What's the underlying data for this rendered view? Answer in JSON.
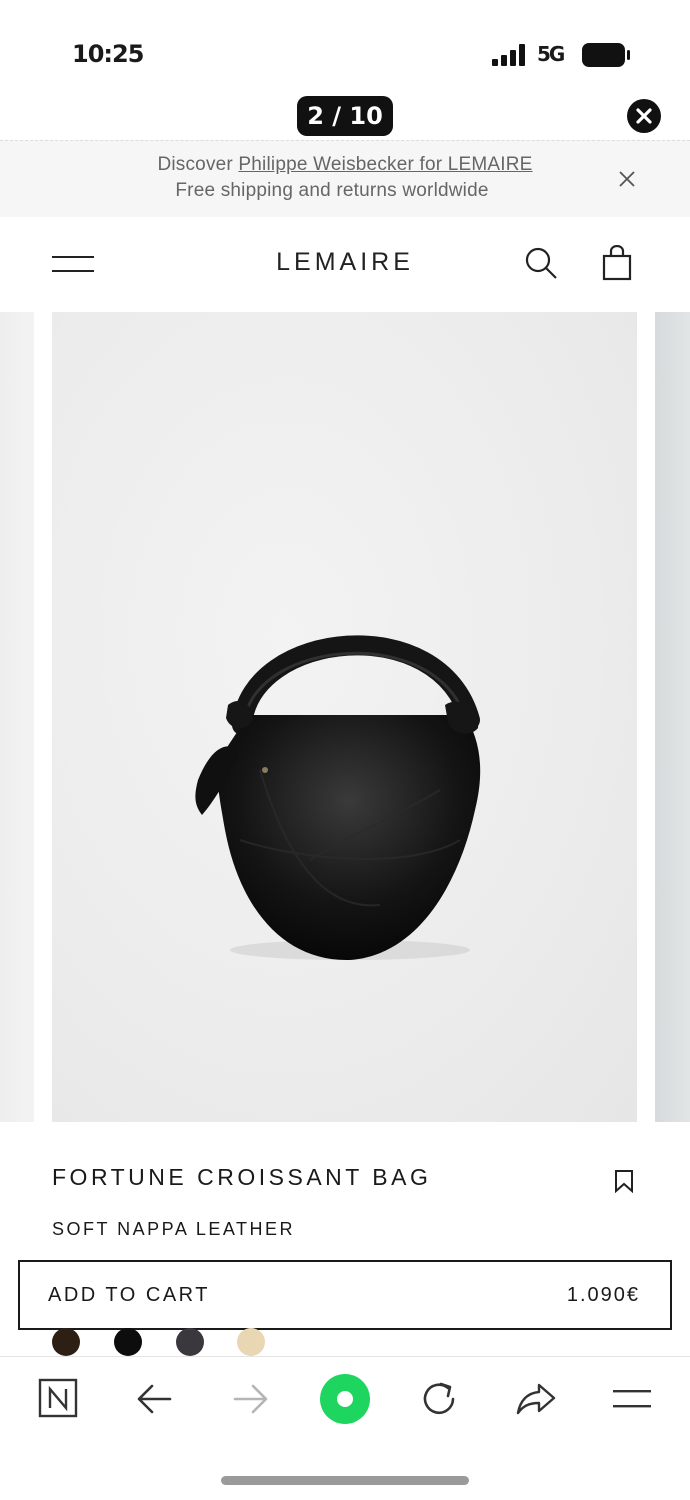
{
  "status_bar": {
    "time": "10:25",
    "network": "5G",
    "battery_icon": "battery-icon",
    "signal_icon": "signal-icon"
  },
  "viewer": {
    "counter": "2 / 10",
    "close_icon": "close-circle-icon"
  },
  "banner": {
    "prefix": "Discover ",
    "link": "Philippe Weisbecker for LEMAIRE",
    "line2": "Free shipping and returns worldwide",
    "close_icon": "close-icon"
  },
  "header": {
    "logo": "LEMAIRE",
    "menu_icon": "hamburger-icon",
    "search_icon": "search-icon",
    "bag_icon": "shopping-bag-icon"
  },
  "product": {
    "name": "FORTUNE CROISSANT BAG",
    "material": "SOFT NAPPA LEATHER",
    "wishlist_icon": "bookmark-icon",
    "add_to_cart": "ADD TO CART",
    "price": "1.090€",
    "swatches": [
      {
        "name": "dark brown",
        "color": "#2e1f14"
      },
      {
        "name": "black",
        "color": "#0d0d0d"
      },
      {
        "name": "dark grey",
        "color": "#3b383d"
      },
      {
        "name": "sand",
        "color": "#e8d7b2"
      }
    ]
  },
  "browser_toolbar": {
    "items": [
      "n-logo-icon",
      "back-arrow-icon",
      "forward-arrow-icon",
      "circle-button-icon",
      "reload-icon",
      "share-icon",
      "menu-lines-icon"
    ],
    "accent": "#1ed65f"
  }
}
